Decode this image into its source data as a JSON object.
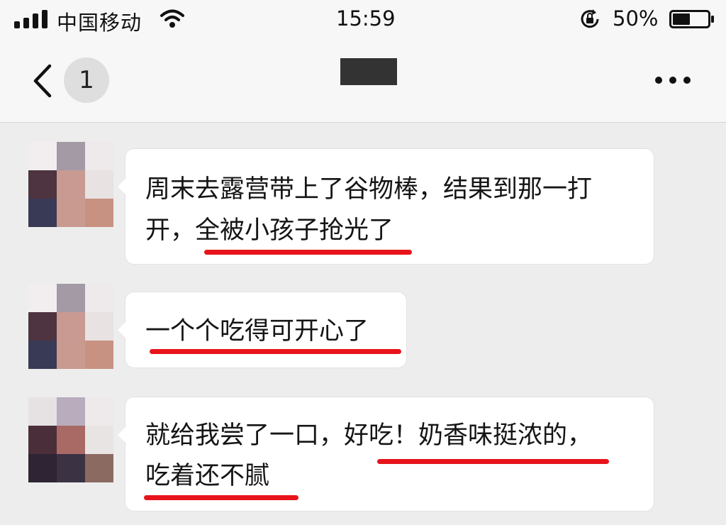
{
  "status_bar": {
    "carrier": "中国移动",
    "time": "15:59",
    "battery_percent": "50%",
    "battery_level": 0.5,
    "icons": [
      "signal-icon",
      "wifi-icon",
      "orientation-lock-icon",
      "battery-icon"
    ]
  },
  "nav": {
    "unread_count": "1",
    "icons": [
      "back-icon",
      "more-icon"
    ]
  },
  "messages": [
    {
      "lines": [
        "周末去露营带上了谷物棒，结果到那一打",
        "开，全被小孩子抢光了"
      ]
    },
    {
      "lines": [
        "一个个吃得可开心了"
      ]
    },
    {
      "lines": [
        "就给我尝了一口，好吃！奶香味挺浓的，",
        "吃着还不腻"
      ]
    }
  ],
  "colors": {
    "background": "#ededed",
    "bubble": "#ffffff",
    "highlight_underline": "#e8141b",
    "bar": "#f7f7f7"
  }
}
